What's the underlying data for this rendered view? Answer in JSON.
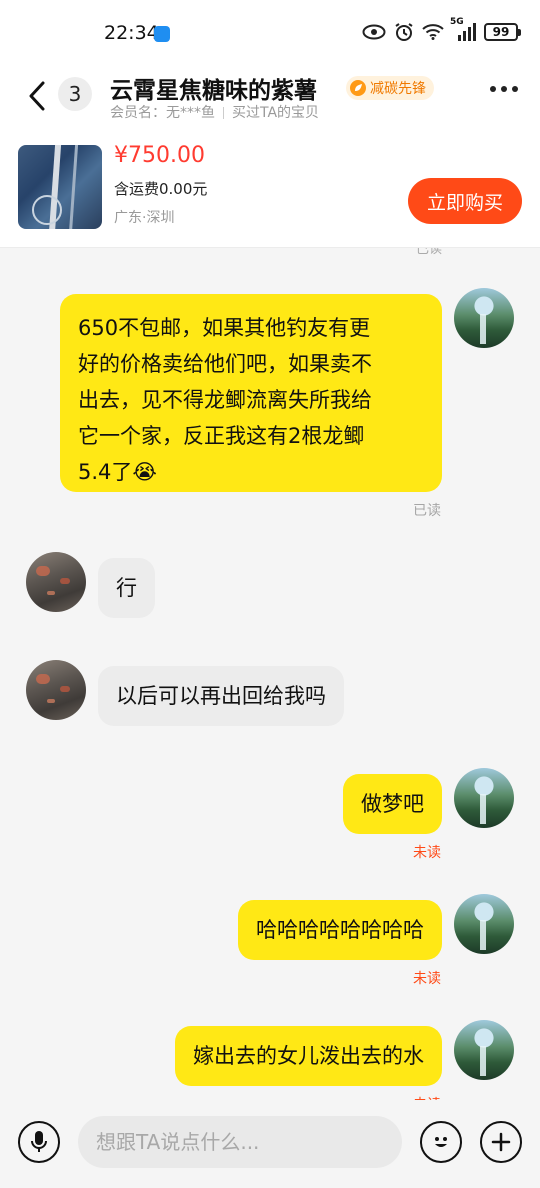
{
  "status_bar": {
    "time": "22:34",
    "network": "5G",
    "battery": "99",
    "icons": [
      "app-notification-icon",
      "eye-icon",
      "alarm-icon",
      "wifi-icon",
      "signal-icon",
      "battery-icon"
    ]
  },
  "header": {
    "back_icon": "chevron-left-icon",
    "unread_count": "3",
    "title": "云霄星焦糖味的紫薯",
    "badge": "减碳先锋",
    "member_label": "会员名：无***鱼",
    "purchase_note": "买过TA的宝贝",
    "more_icon": "more-dots-icon"
  },
  "product": {
    "price": "¥750.00",
    "shipping": "含运费0.00元",
    "location": "广东·深圳",
    "buy_label": "立即购买"
  },
  "chat": {
    "partial_receipt": "已读",
    "messages": [
      {
        "from": "me",
        "lines": [
          "650不包邮，如果其他钓友有更",
          "好的价格卖给他们吧，如果卖不",
          "出去，见不得龙鲫流离失所我给",
          "它一个家，反正我这有2根龙鲫",
          "5.4了😭"
        ],
        "receipt": "已读"
      },
      {
        "from": "other",
        "text": "行"
      },
      {
        "from": "other",
        "text": "以后可以再出回给我吗"
      },
      {
        "from": "me",
        "text": "做梦吧",
        "receipt": "未读"
      },
      {
        "from": "me",
        "text": "哈哈哈哈哈哈哈哈",
        "receipt": "未读"
      },
      {
        "from": "me",
        "text": "嫁出去的女儿泼出去的水",
        "receipt": "未读"
      }
    ]
  },
  "input_bar": {
    "placeholder": "想跟TA说点什么...",
    "voice_icon": "microphone-icon",
    "emoji_icon": "emoji-icon",
    "plus_icon": "plus-icon"
  },
  "colors": {
    "my_bubble": "#ffe815",
    "their_bubble": "#ececec",
    "accent": "#ff4a17",
    "price": "#ff3b30",
    "badge_text": "#f07a00"
  }
}
